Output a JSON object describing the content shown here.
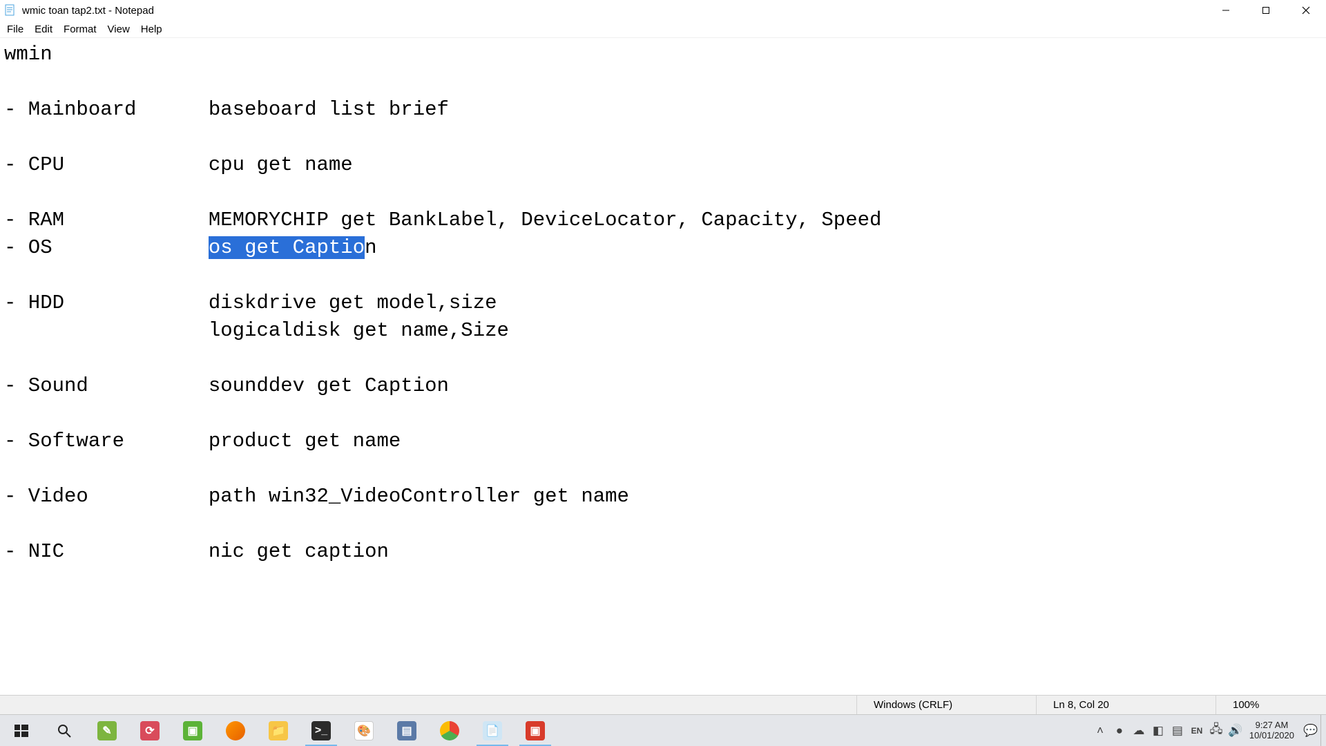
{
  "titlebar": {
    "title": "wmic toan tap2.txt - Notepad"
  },
  "menu": {
    "file": "File",
    "edit": "Edit",
    "format": "Format",
    "view": "View",
    "help": "Help"
  },
  "content": {
    "l1": "wmin",
    "l2": "",
    "l3": "- Mainboard      baseboard list brief",
    "l4": "",
    "l5": "- CPU            cpu get name",
    "l6": "",
    "l7": "- RAM            MEMORYCHIP get BankLabel, DeviceLocator, Capacity, Speed",
    "l8_prefix": "- OS             ",
    "l8_selected": "os get Captio",
    "l8_suffix": "n",
    "l9": "",
    "l10": "- HDD            diskdrive get model,size",
    "l11": "                 logicaldisk get name,Size",
    "l12": "",
    "l13": "- Sound          sounddev get Caption",
    "l14": "",
    "l15": "- Software       product get name",
    "l16": "",
    "l17": "- Video          path win32_VideoController get name",
    "l18": "",
    "l19": "- NIC            nic get caption",
    "l20": ""
  },
  "status": {
    "encoding_hint": "Windows (CRLF)",
    "position": "Ln 8, Col 20",
    "zoom": "100%"
  },
  "taskbar": {
    "time": "9:27 AM",
    "date": "10/01/2020"
  }
}
